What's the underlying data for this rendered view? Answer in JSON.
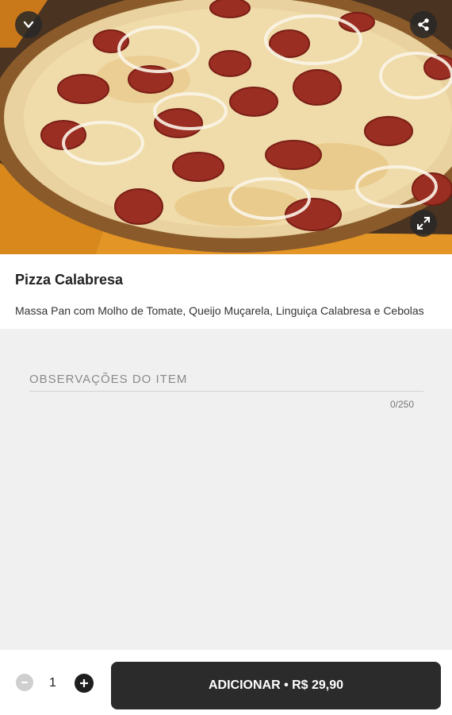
{
  "product": {
    "name": "Pizza Calabresa",
    "description": "Massa Pan com Molho de Tomate, Queijo Muçarela, Linguiça Calabresa e Cebolas"
  },
  "hero": {
    "image_alt": "pizza-photo",
    "buttons": {
      "back": "chevron-down-icon",
      "share": "share-icon",
      "expand": "expand-icon"
    }
  },
  "notes": {
    "placeholder": "OBSERVAÇÕES DO ITEM",
    "value": "",
    "counter": "0/250"
  },
  "cart": {
    "quantity": "1",
    "add_label": "ADICIONAR • R$ 29,90"
  },
  "colors": {
    "add_button": "#2b2b2b",
    "background": "#f0f0f0"
  }
}
